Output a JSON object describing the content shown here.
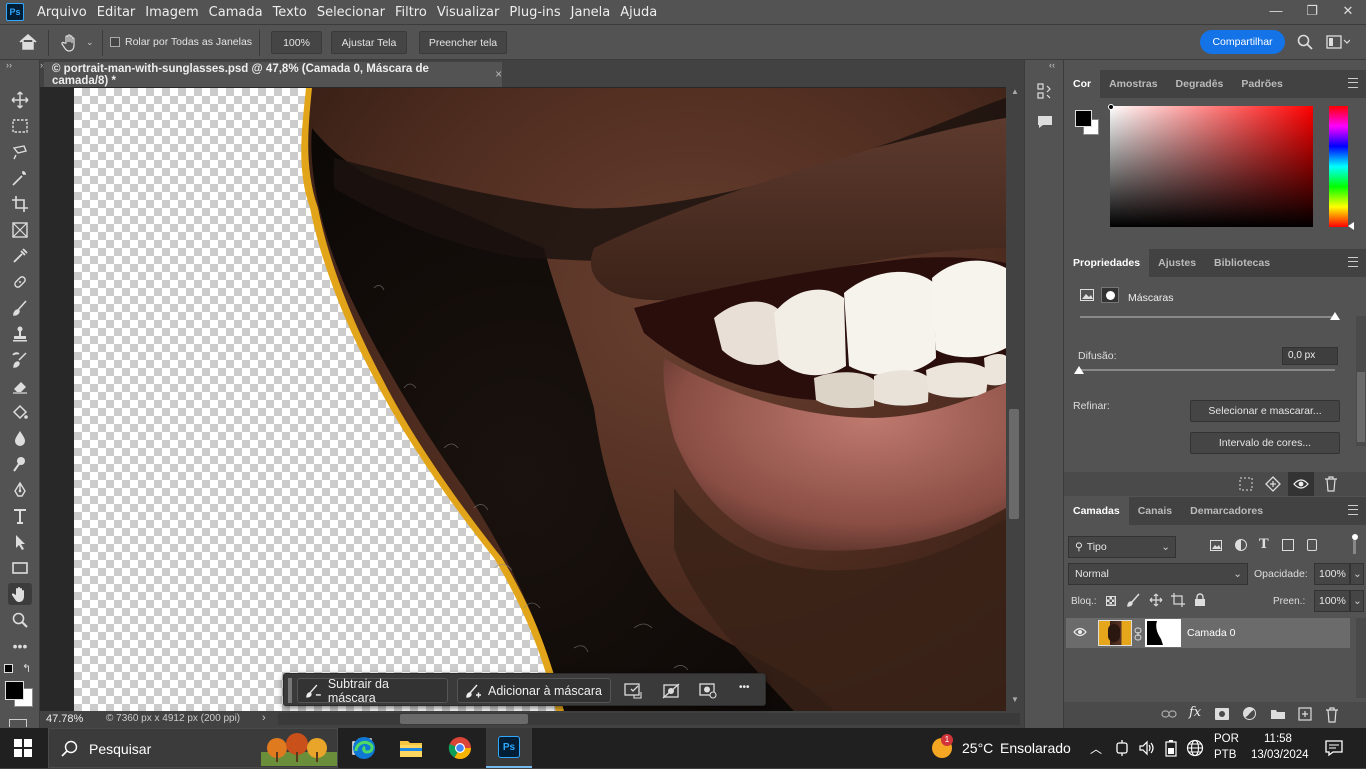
{
  "app": {
    "logo": "Ps"
  },
  "menu": [
    "Arquivo",
    "Editar",
    "Imagem",
    "Camada",
    "Texto",
    "Selecionar",
    "Filtro",
    "Visualizar",
    "Plug-ins",
    "Janela",
    "Ajuda"
  ],
  "window_controls": {
    "minimize": "—",
    "restore": "❐",
    "close": "✕"
  },
  "options": {
    "scroll_all_label": "Rolar por Todas as Janelas",
    "zoom_btn": "100%",
    "fit_btn": "Ajustar Tela",
    "fill_btn": "Preencher tela",
    "share": "Compartilhar"
  },
  "document": {
    "tab_title": "© portrait-man-with-sunglasses.psd @ 47,8% (Camada 0, Máscara de camada/8) *",
    "close": "×"
  },
  "status": {
    "zoom": "47.78%",
    "info": "© 7360 px x 4912 px (200 ppi)",
    "arrow": "›"
  },
  "maskbar": {
    "subtract": "Subtrair da máscara",
    "add": "Adicionar à máscara",
    "more": "•••"
  },
  "color_panel": {
    "tabs": [
      "Cor",
      "Amostras",
      "Degradês",
      "Padrões"
    ],
    "fg": "#000000",
    "bg": "#ffffff",
    "hue": "#ff0000"
  },
  "properties": {
    "tabs": [
      "Propriedades",
      "Ajustes",
      "Bibliotecas"
    ],
    "masks_label": "Máscaras",
    "feather_label": "Difusão:",
    "feather_value": "0,0 px",
    "refine_label": "Refinar:",
    "select_mask_btn": "Selecionar e mascarar...",
    "color_range_btn": "Intervalo de cores..."
  },
  "layers": {
    "tabs": [
      "Camadas",
      "Canais",
      "Demarcadores"
    ],
    "filter": "Tipo",
    "blend_mode": "Normal",
    "opacity_label": "Opacidade:",
    "opacity": "100%",
    "lock_label": "Bloq.:",
    "fill_label": "Preen.:",
    "fill": "100%",
    "items": [
      {
        "name": "Camada 0"
      }
    ]
  },
  "taskbar": {
    "search": "Pesquisar",
    "weather_temp": "25°C",
    "weather_text": "Ensolarado",
    "weather_badge": "1",
    "lang1": "POR",
    "lang2": "PTB",
    "time": "11:58",
    "date": "13/03/2024"
  },
  "colors": {
    "accent": "#1473e6",
    "panel": "#535353",
    "dark": "#424242"
  }
}
